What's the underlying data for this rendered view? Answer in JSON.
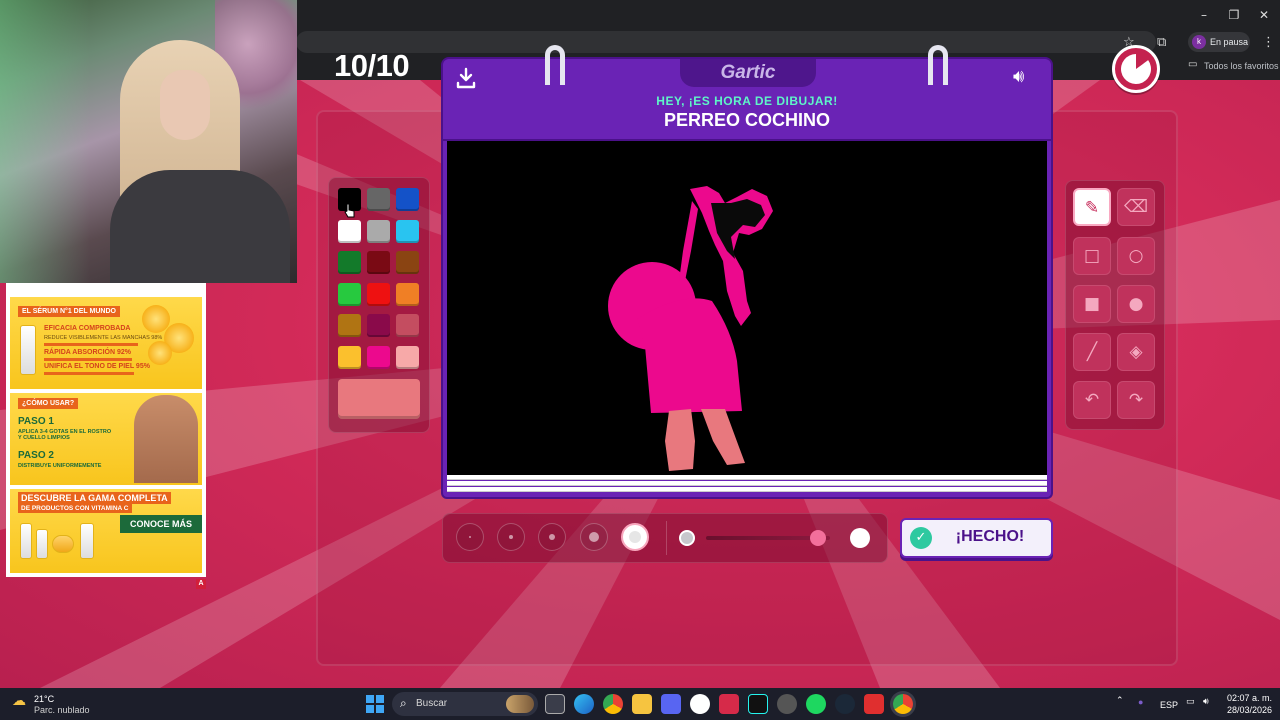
{
  "browser": {
    "profile_initial": "k",
    "profile_status": "En pausa",
    "bookmarks_folder": "Todos los favoritos",
    "window_controls": {
      "minimize": "–",
      "restore": "❐",
      "close": "✕"
    },
    "icons": [
      "star-icon",
      "extensions-icon",
      "menu-icon",
      "folder-icon"
    ]
  },
  "game": {
    "round": "10/10",
    "logo": "Gartic",
    "prompt_subtitle": "HEY, ¡ES HORA DE DIBUJAR!",
    "prompt_word": "PERREO COCHINO",
    "done_label": "¡HECHO!",
    "timer_remaining_fraction": 0.85,
    "current_color": "#e8787e",
    "palette": [
      "#000000",
      "#666666",
      "#1452c8",
      "#ffffff",
      "#aaaaaa",
      "#29c4f0",
      "#137a2a",
      "#7a0a14",
      "#8a4412",
      "#27c93f",
      "#ee1111",
      "#f07f25",
      "#b07413",
      "#8a0a4a",
      "#c44d60",
      "#fbc02d",
      "#ec098d",
      "#f7a9a8"
    ],
    "tools": [
      "pencil-icon",
      "eraser-icon",
      "rectangle-outline-icon",
      "ellipse-outline-icon",
      "rectangle-fill-icon",
      "ellipse-fill-icon",
      "line-icon",
      "fill-bucket-icon",
      "undo-icon",
      "redo-icon"
    ],
    "active_tool": "pencil-icon",
    "brush_sizes": 5,
    "active_brush_size_index": 4,
    "opacity_level": 0.9,
    "colors": {
      "brand_purple": "#6a23b5",
      "accent_green": "#5ff5c8",
      "drawing_pink": "#ec098d",
      "drawing_salmon": "#e8787e"
    }
  },
  "ad": {
    "tag_1": "EL SÉRUM N°1 DEL MUNDO",
    "claim_1": "EFICACIA COMPROBADA",
    "claim_1_sub": "REDUCE VISIBLEMENTE LAS MANCHAS 98%",
    "claim_2": "RÁPIDA ABSORCIÓN 92%",
    "claim_3": "UNIFICA EL TONO DE PIEL 95%",
    "tag_2": "¿CÓMO USAR?",
    "step_1_title": "PASO 1",
    "step_1_text": "APLICA 3-4 GOTAS EN EL ROSTRO Y CUELLO LIMPIOS",
    "step_2_title": "PASO 2",
    "step_2_text": "DISTRIBUYE UNIFORMEMENTE",
    "range_title": "DESCUBRE LA GAMA COMPLETA",
    "range_sub": "DE PRODUCTOS CON VITAMINA C",
    "cta": "CONOCE MÁS",
    "badge": "A"
  },
  "taskbar": {
    "temperature": "21°C",
    "weather": "Parc. nublado",
    "search_label": "Buscar",
    "lang": "ESP",
    "time": "02:07 a. m.",
    "date": "28/03/2026"
  }
}
